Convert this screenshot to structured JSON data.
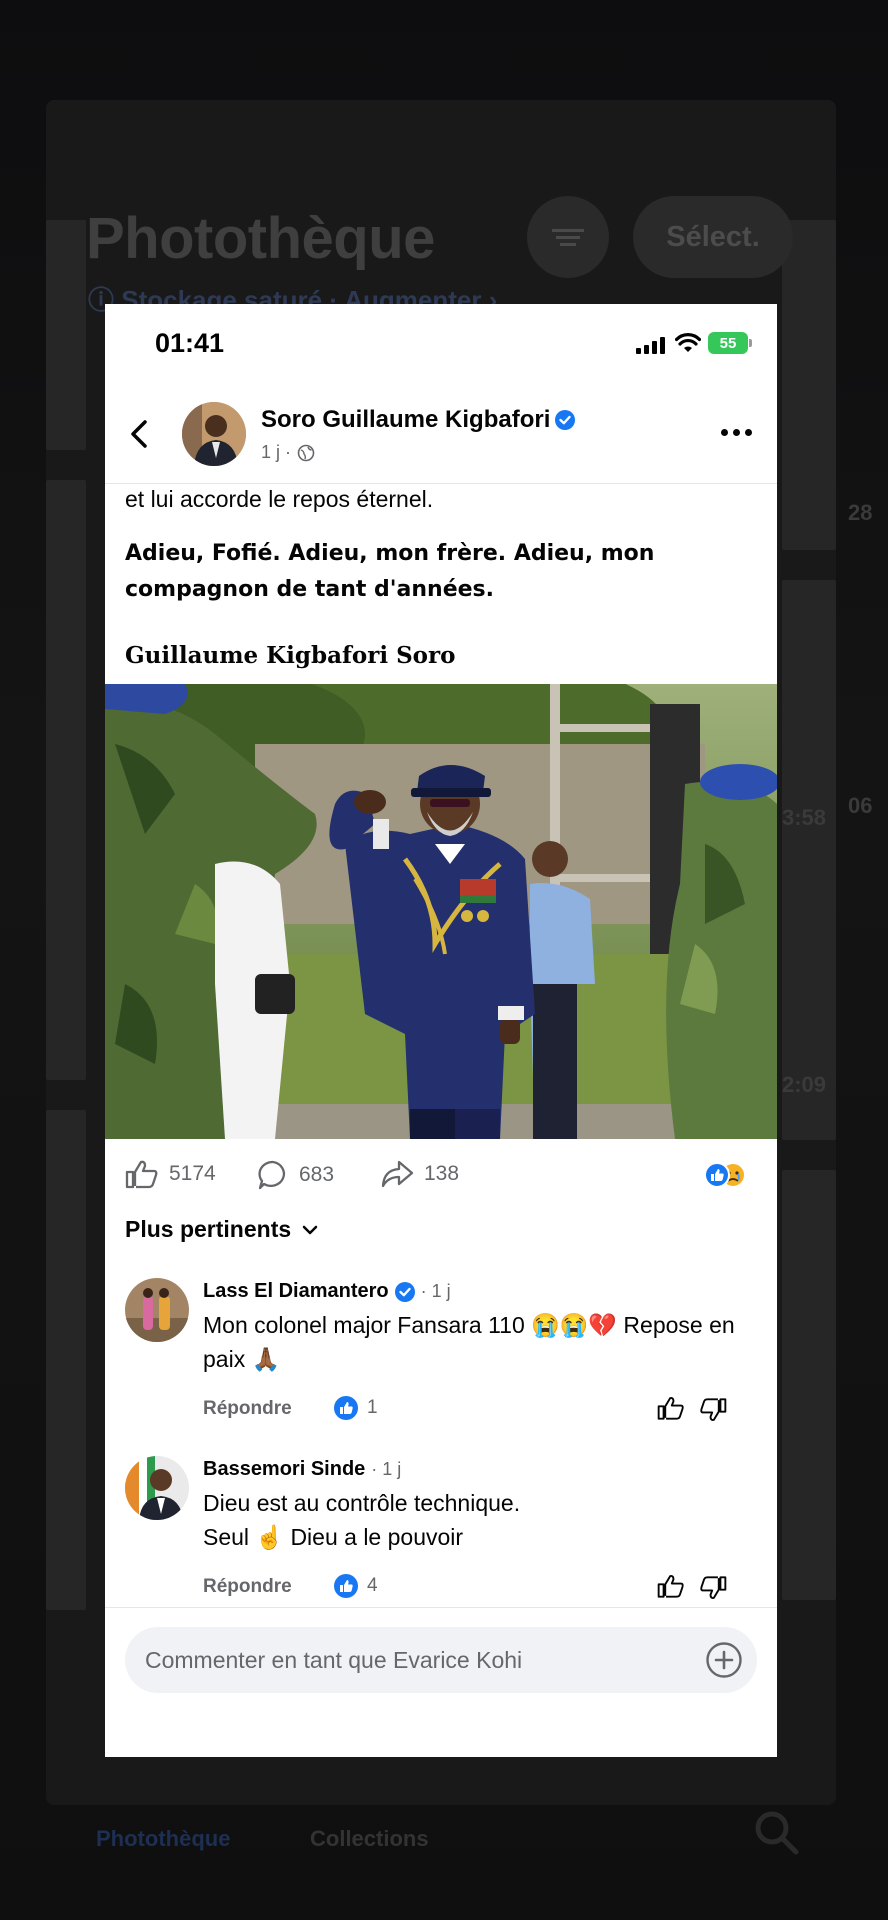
{
  "background": {
    "app_title": "Photothèque",
    "storage_notice": "ⓘ Stockage saturé · Augmenter ›",
    "select_button": "Sélect.",
    "tabs": [
      "Photothèque",
      "Collections"
    ],
    "times": [
      "28",
      "3:58",
      "06",
      "2:09"
    ]
  },
  "status_bar": {
    "time": "01:41",
    "battery": "55"
  },
  "post": {
    "author": "Soro Guillaume Kigbafori",
    "age": "1 j ·",
    "text_fragment": "et lui accorde le repos éternel.",
    "bold_paragraph": "Adieu, Fofié. Adieu, mon frère. Adieu, mon compagnon de tant d'années.",
    "signature": "Guillaume Kigbafori Soro"
  },
  "stats": {
    "likes": "5174",
    "comments": "683",
    "shares": "138"
  },
  "sort_label": "Plus pertinents",
  "comments": [
    {
      "author": "Lass El Diamantero",
      "age": "· 1 j",
      "text": "Mon colonel major Fansara 110 😭😭💔 Repose en paix 🙏🏾",
      "reply_label": "Répondre",
      "likes": "1"
    },
    {
      "author": "Bassemori Sinde",
      "age": "· 1 j",
      "text_line1": "Dieu est au contrôle technique.",
      "text_line2": "Seul ☝️ Dieu a le pouvoir",
      "reply_label": "Répondre",
      "likes": "4"
    }
  ],
  "composer": {
    "placeholder": "Commenter en tant que Evarice Kohi"
  },
  "colors": {
    "facebook_blue": "#1877f2",
    "battery_green": "#35c759",
    "meta_gray": "#65676b"
  }
}
